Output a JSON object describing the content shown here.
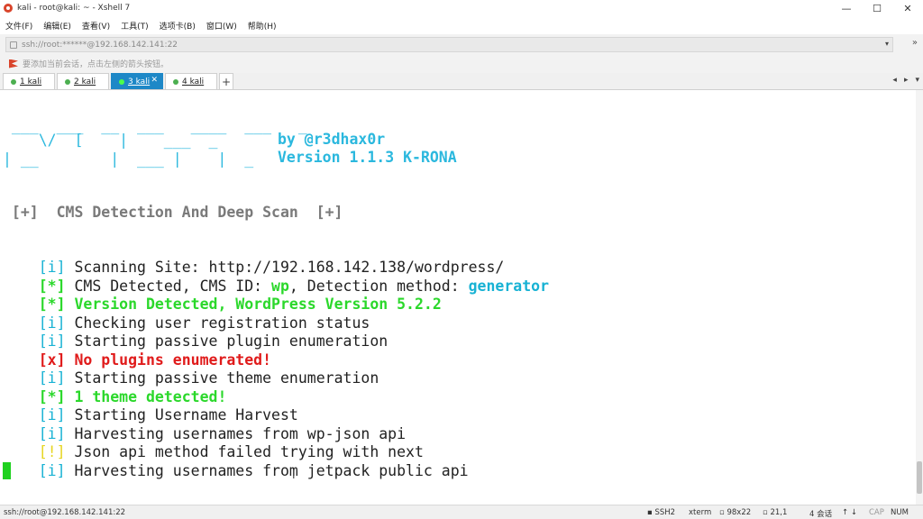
{
  "window": {
    "title": "kali - root@kali: ~ - Xshell 7",
    "minimize": "—",
    "maximize": "☐",
    "close": "✕"
  },
  "menu": [
    "文件(F)",
    "编辑(E)",
    "查看(V)",
    "工具(T)",
    "选项卡(B)",
    "窗口(W)",
    "帮助(H)"
  ],
  "address": {
    "value": "ssh://root:******@192.168.142.141:22",
    "dropdown": "▾"
  },
  "hint": "要添加当前会话，点击左侧的箭头按钮。",
  "tabs": [
    {
      "label": "1 kali",
      "active": false
    },
    {
      "label": "2 kali",
      "active": false
    },
    {
      "label": "3 kali",
      "active": true
    },
    {
      "label": "4 kali",
      "active": false
    }
  ],
  "tab_add": "+",
  "tab_nav": [
    "◂",
    "▸",
    "▾"
  ],
  "terminal": {
    "banner": {
      "line1": " ___  ___  __  ___   ____  ___   _",
      "line2": "    \\/  [    |    ___  _",
      "line3": "| __        |  ___ |    |  _",
      "author": "by @r3dhax0r",
      "version": "Version 1.1.3 K-RONA"
    },
    "section": " [+]  CMS Detection And Deep Scan  [+]",
    "lines": [
      {
        "tag": "[i]",
        "text": " Scanning Site: http://192.168.142.138/wordpress/"
      },
      {
        "tag": "[*]",
        "text": " CMS Detected, CMS ID: ",
        "cms_id": "wp",
        "mid": ", Detection method: ",
        "method": "generator"
      },
      {
        "tag": "[*]",
        "text": " Version Detected, WordPress Version 5.2.2"
      },
      {
        "tag": "[i]",
        "text": " Checking user registration status"
      },
      {
        "tag": "[i]",
        "text": " Starting passive plugin enumeration"
      },
      {
        "tag": "[x]",
        "text": " No plugins enumerated!"
      },
      {
        "tag": "[i]",
        "text": " Starting passive theme enumeration"
      },
      {
        "tag": "[*]",
        "text": " 1 theme detected!"
      },
      {
        "tag": "[i]",
        "text": " Starting Username Harvest"
      },
      {
        "tag": "[i]",
        "text": " Harvesting usernames from wp-json api"
      },
      {
        "tag": "[!]",
        "text": " Json api method failed trying with next"
      },
      {
        "tag": "[i]",
        "text": " Harvesting usernames from jetpack public api"
      }
    ]
  },
  "status": {
    "connection": "ssh://root@192.168.142.141:22",
    "protocol": "SSH2",
    "term": "xterm",
    "size": "98x22",
    "position": "21,1",
    "sessions": "4 会话",
    "cap": "CAP",
    "num": "NUM"
  },
  "colors": {
    "tab_active": "#1e88c7",
    "cursor": "#1fd11f",
    "info": "#18b2d4",
    "success": "#2bd82b",
    "error": "#e01b1b",
    "warning": "#e6d51f"
  }
}
